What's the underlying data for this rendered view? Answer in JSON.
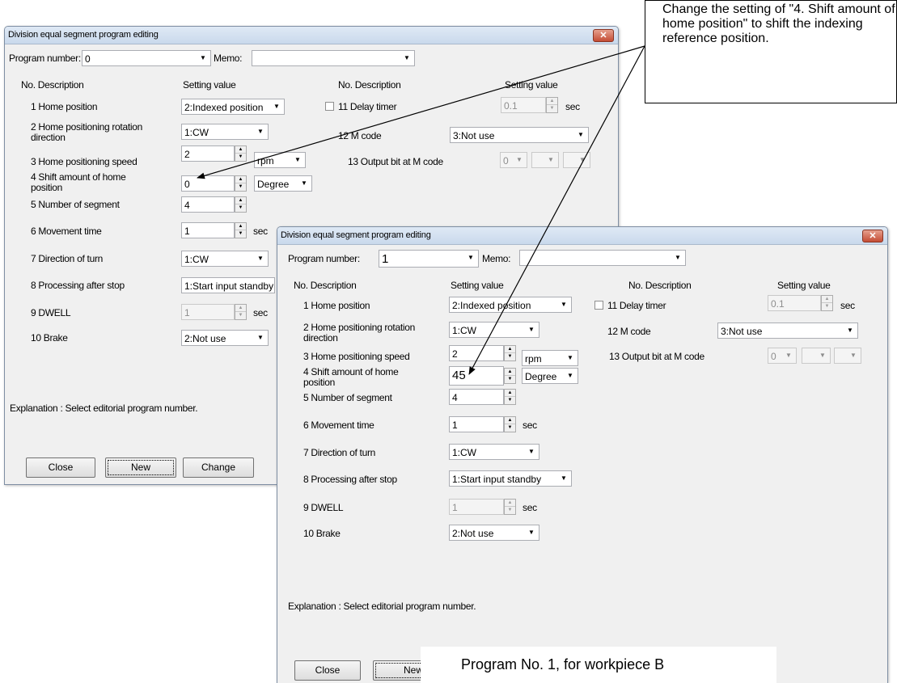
{
  "dialogs": {
    "back": {
      "title": "Division equal segment program editing",
      "close_glyph": "✕",
      "program_number_label": "Program number:",
      "program_number_value": "0",
      "memo_label": "Memo:",
      "memo_value": "",
      "col_no_desc_left": "No.   Description",
      "col_setting_left": "Setting value",
      "col_no_desc_right": "No.   Description",
      "col_setting_right": "Setting value",
      "rows": {
        "r1": {
          "label": "1 Home position",
          "value": "2:Indexed position"
        },
        "r2": {
          "label": "2 Home positioning rotation direction",
          "value": "1:CW"
        },
        "r3": {
          "label": "3 Home positioning speed",
          "value": "2",
          "unit": "rpm"
        },
        "r4": {
          "label": "4 Shift amount of home position",
          "value": "0",
          "unit": "Degree"
        },
        "r5": {
          "label": "5 Number of segment",
          "value": "4"
        },
        "r6": {
          "label": "6 Movement time",
          "value": "1",
          "unit": "sec"
        },
        "r7": {
          "label": "7 Direction of turn",
          "value": "1:CW"
        },
        "r8": {
          "label": "8 Processing after stop",
          "value": "1:Start input standby"
        },
        "r9": {
          "label": "9 DWELL",
          "value": "1",
          "unit": "sec"
        },
        "r10": {
          "label": "10 Brake",
          "value": "2:Not use"
        },
        "r11": {
          "label": "11 Delay timer",
          "value": "0.1",
          "unit": "sec",
          "checked": false
        },
        "r12": {
          "label": "12 M code",
          "value": "3:Not use"
        },
        "r13": {
          "label": "13 Output bit at M code",
          "value": "0"
        }
      },
      "explanation": "Explanation :    Select editorial program number.",
      "buttons": {
        "close": "Close",
        "new": "New",
        "change": "Change"
      }
    },
    "front": {
      "title": "Division equal segment program editing",
      "close_glyph": "✕",
      "program_number_label": "Program number:",
      "program_number_value": "1",
      "memo_label": "Memo:",
      "memo_value": "",
      "col_no_desc_left": "No.   Description",
      "col_setting_left": "Setting value",
      "col_no_desc_right": "No.   Description",
      "col_setting_right": "Setting value",
      "rows": {
        "r1": {
          "label": "1 Home position",
          "value": "2:Indexed position"
        },
        "r2": {
          "label": "2 Home positioning rotation direction",
          "value": "1:CW"
        },
        "r3": {
          "label": "3 Home positioning speed",
          "value": "2",
          "unit": "rpm"
        },
        "r4": {
          "label": "4 Shift amount of home position",
          "value": "45",
          "unit": "Degree"
        },
        "r5": {
          "label": "5 Number of segment",
          "value": "4"
        },
        "r6": {
          "label": "6 Movement time",
          "value": "1",
          "unit": "sec"
        },
        "r7": {
          "label": "7 Direction of turn",
          "value": "1:CW"
        },
        "r8": {
          "label": "8 Processing after stop",
          "value": "1:Start input standby"
        },
        "r9": {
          "label": "9 DWELL",
          "value": "1",
          "unit": "sec"
        },
        "r10": {
          "label": "10 Brake",
          "value": "2:Not use"
        },
        "r11": {
          "label": "11 Delay timer",
          "value": "0.1",
          "unit": "sec",
          "checked": false
        },
        "r12": {
          "label": "12 M code",
          "value": "3:Not use"
        },
        "r13": {
          "label": "13 Output bit at M code",
          "value": "0"
        }
      },
      "explanation": "Explanation :    Select editorial program number.",
      "buttons": {
        "close": "Close",
        "new": "New"
      }
    }
  },
  "annotations": {
    "callout": "Change the setting of \"4. Shift amount of home position\" to shift the indexing reference position.",
    "caption": "Program No. 1, for workpiece B"
  },
  "icons": {
    "dropdown": "chevron-down-icon",
    "spin_up": "spin-up-icon",
    "spin_down": "spin-down-icon",
    "close": "close-icon"
  },
  "colors": {
    "close_button": "#c44c34",
    "dialog_bg": "#f0f0f0",
    "titlebar": "#c9d9ec"
  }
}
